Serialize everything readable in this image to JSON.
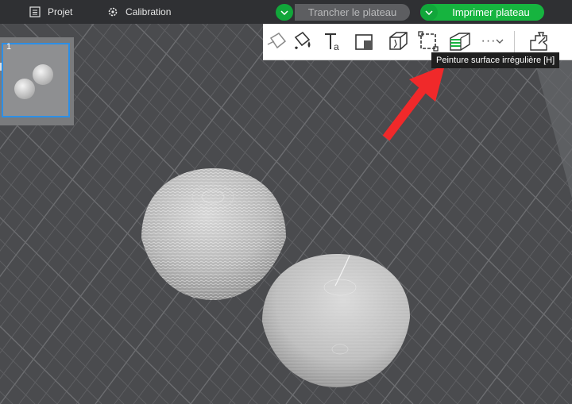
{
  "topbar": {
    "project_label": "Projet",
    "calibration_label": "Calibration",
    "slice_label": "Trancher le plateau",
    "print_label": "Imprimer plateau"
  },
  "toolbar": {
    "more_label": "···",
    "tooltip": "Peinture surface irrégulière [H]"
  },
  "thumbnail": {
    "plate_number": "1"
  },
  "colors": {
    "accent_green": "#16b43f",
    "annotation_arrow": "#f0292a",
    "selection_blue": "#2d8fe6"
  }
}
